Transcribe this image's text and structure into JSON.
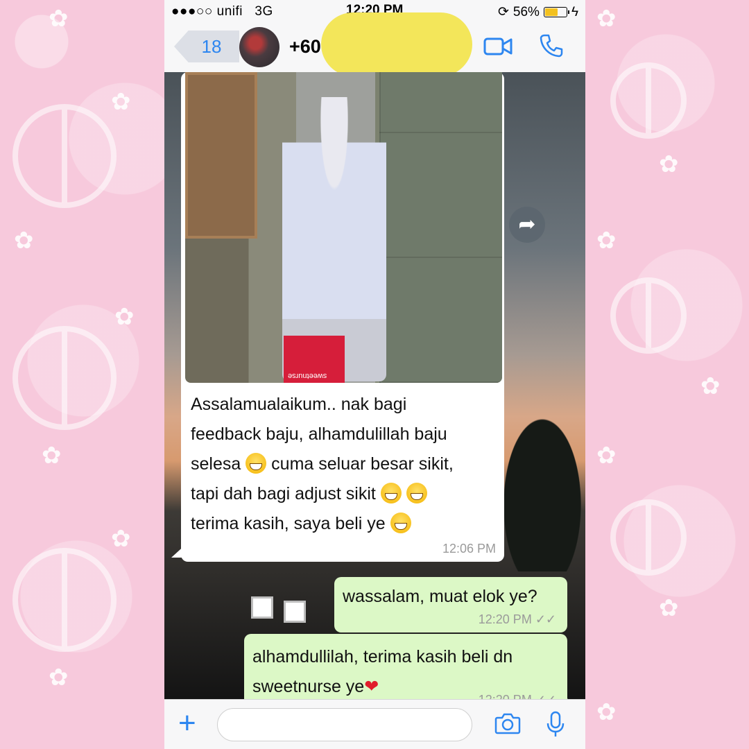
{
  "status_bar": {
    "signal": "●●●○○",
    "carrier": "unifi",
    "network": "3G",
    "time": "12:20 PM",
    "battery_percent": "56%",
    "battery_level": 0.56
  },
  "header": {
    "back_count": "18",
    "contact_prefix": "+60",
    "icons": [
      "video-call-icon",
      "phone-icon"
    ],
    "accent_color": "#2d86f0"
  },
  "messages": {
    "incoming": {
      "lines": [
        "Assalamualaikum.. nak bagi",
        "feedback baju, alhamdulillah baju",
        "selesa",
        "cuma seluar besar sikit,",
        "tapi dah bagi adjust sikit",
        "terima kasih, saya beli ye"
      ],
      "photo_bag_text": "sweetnurse",
      "time": "12:06 PM"
    },
    "outgoing": [
      {
        "text": "wassalam, muat elok ye?",
        "time": "12:20 PM"
      },
      {
        "line1": "alhamdullilah, terima kasih beli dn",
        "line2": "sweetnurse ye",
        "time": "12:20 PM"
      }
    ]
  },
  "input_bar": {
    "icons": [
      "plus-icon",
      "camera-icon",
      "microphone-icon"
    ]
  },
  "colors": {
    "outgoing_bubble": "#dcf8c6",
    "incoming_bubble": "#ffffff",
    "redaction": "#f3e65a",
    "background": "#f7c9dc"
  }
}
